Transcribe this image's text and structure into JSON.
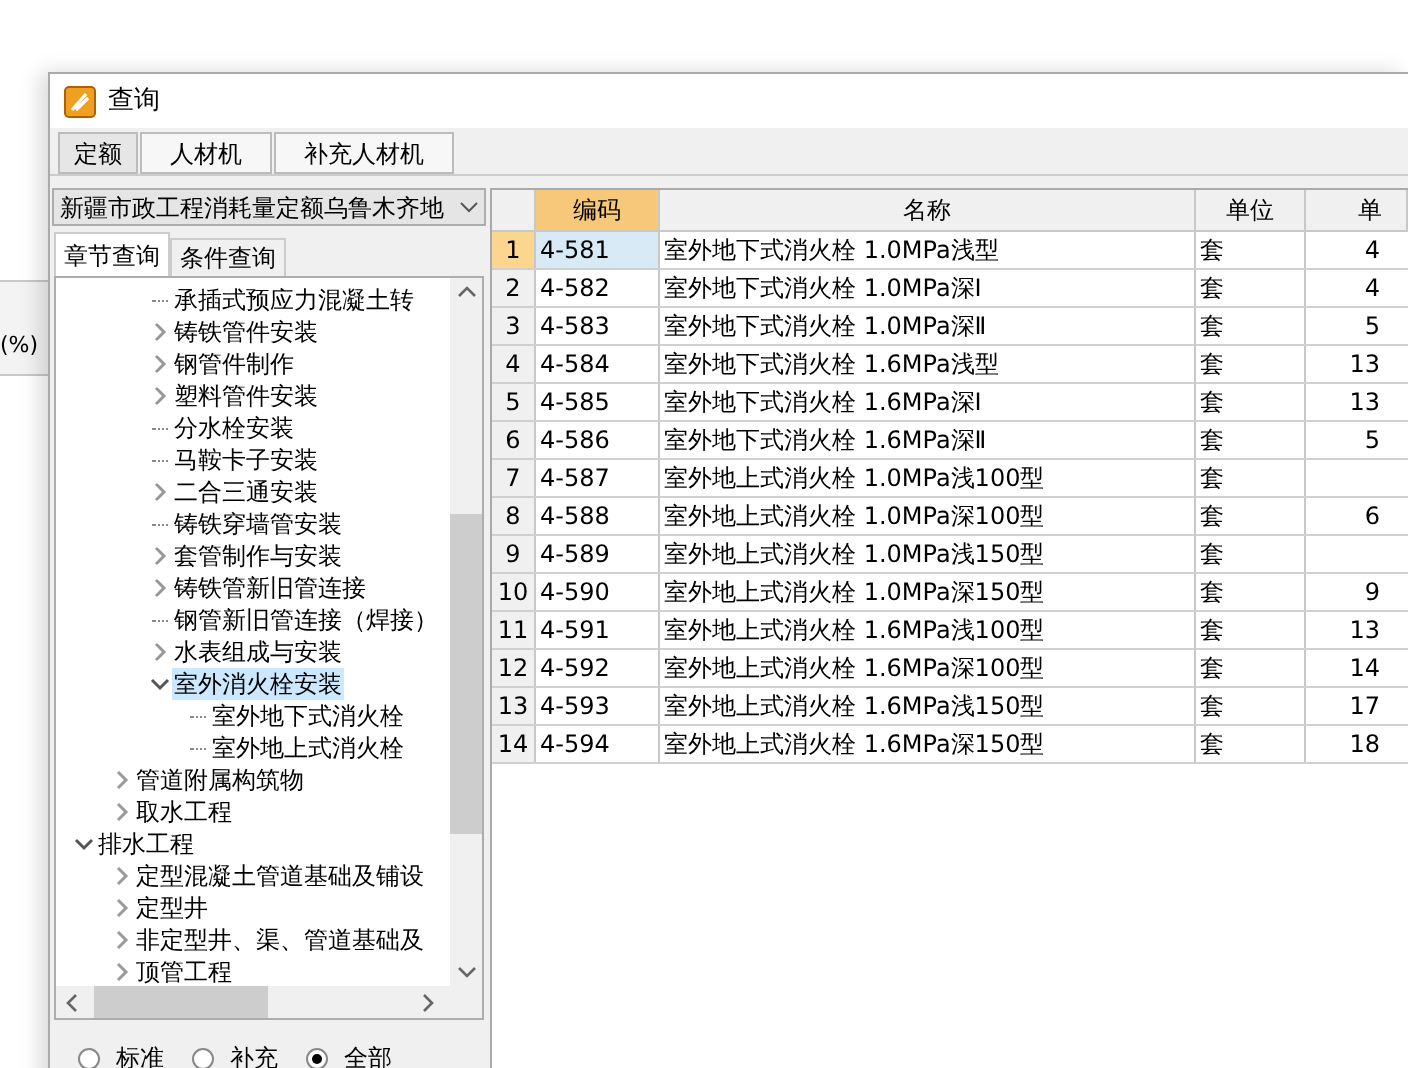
{
  "background": {
    "column_label": "(%)"
  },
  "window": {
    "title": "查询"
  },
  "tabs": [
    {
      "label": "定额",
      "selected": true
    },
    {
      "label": "人材机",
      "selected": false
    },
    {
      "label": "补充人材机",
      "selected": false
    }
  ],
  "quota_dropdown": {
    "value": "新疆市政工程消耗量定额乌鲁木齐地"
  },
  "search_tabs": [
    {
      "label": "章节查询",
      "selected": true
    },
    {
      "label": "条件查询",
      "selected": false
    }
  ],
  "tree": [
    {
      "children": [
        {
          "children": [
            {
              "label": "承插式预应力混凝土转",
              "kind": "leaf",
              "selected": false
            },
            {
              "label": "铸铁管件安装",
              "kind": "branch",
              "expanded": false,
              "selected": false
            },
            {
              "label": "钢管件制作",
              "kind": "branch",
              "expanded": false,
              "selected": false
            },
            {
              "label": "塑料管件安装",
              "kind": "branch",
              "expanded": false,
              "selected": false
            },
            {
              "label": "分水栓安装",
              "kind": "leaf",
              "selected": false
            },
            {
              "label": "马鞍卡子安装",
              "kind": "leaf",
              "selected": false
            },
            {
              "label": "二合三通安装",
              "kind": "branch",
              "expanded": false,
              "selected": false
            },
            {
              "label": "铸铁穿墙管安装",
              "kind": "leaf",
              "selected": false
            },
            {
              "label": "套管制作与安装",
              "kind": "branch",
              "expanded": false,
              "selected": false
            },
            {
              "label": "铸铁管新旧管连接",
              "kind": "branch",
              "expanded": false,
              "selected": false
            },
            {
              "label": "钢管新旧管连接（焊接）",
              "kind": "leaf",
              "selected": false
            },
            {
              "label": "水表组成与安装",
              "kind": "branch",
              "expanded": false,
              "selected": false
            },
            {
              "label": "室外消火栓安装",
              "kind": "branch",
              "expanded": true,
              "selected": true,
              "children": [
                {
                  "label": "室外地下式消火栓",
                  "kind": "leaf",
                  "selected": false
                },
                {
                  "label": "室外地上式消火栓",
                  "kind": "leaf",
                  "selected": false
                }
              ]
            }
          ]
        },
        {
          "label": "管道附属构筑物",
          "kind": "branch",
          "expanded": false,
          "selected": false
        },
        {
          "label": "取水工程",
          "kind": "branch",
          "expanded": false,
          "selected": false
        }
      ]
    },
    {
      "label": "排水工程",
      "kind": "branch",
      "expanded": true,
      "selected": false,
      "children": [
        {
          "label": "定型混凝土管道基础及铺设",
          "kind": "branch",
          "expanded": false,
          "selected": false
        },
        {
          "label": "定型井",
          "kind": "branch",
          "expanded": false,
          "selected": false
        },
        {
          "label": "非定型井、渠、管道基础及",
          "kind": "branch",
          "expanded": false,
          "selected": false
        },
        {
          "label": "顶管工程",
          "kind": "branch",
          "expanded": false,
          "selected": false
        }
      ]
    }
  ],
  "filter": [
    {
      "label": "标准",
      "selected": false
    },
    {
      "label": "补充",
      "selected": false
    },
    {
      "label": "全部",
      "selected": true
    }
  ],
  "table": {
    "columns": [
      {
        "label": "编码",
        "selected": true
      },
      {
        "label": "名称",
        "selected": false
      },
      {
        "label": "单位",
        "selected": false
      },
      {
        "label": "单",
        "selected": false
      }
    ],
    "rows": [
      {
        "index": "1",
        "code": "4-581",
        "name": "室外地下式消火栓 1.0MPa浅型",
        "unit": "套",
        "price": "4",
        "selected": true
      },
      {
        "index": "2",
        "code": "4-582",
        "name": "室外地下式消火栓 1.0MPa深Ⅰ",
        "unit": "套",
        "price": "4",
        "selected": false
      },
      {
        "index": "3",
        "code": "4-583",
        "name": "室外地下式消火栓 1.0MPa深Ⅱ",
        "unit": "套",
        "price": "5",
        "selected": false
      },
      {
        "index": "4",
        "code": "4-584",
        "name": "室外地下式消火栓 1.6MPa浅型",
        "unit": "套",
        "price": "13",
        "selected": false
      },
      {
        "index": "5",
        "code": "4-585",
        "name": "室外地下式消火栓 1.6MPa深Ⅰ",
        "unit": "套",
        "price": "13",
        "selected": false
      },
      {
        "index": "6",
        "code": "4-586",
        "name": "室外地下式消火栓 1.6MPa深Ⅱ",
        "unit": "套",
        "price": "5",
        "selected": false
      },
      {
        "index": "7",
        "code": "4-587",
        "name": "室外地上式消火栓 1.0MPa浅100型",
        "unit": "套",
        "selected": false
      },
      {
        "index": "8",
        "code": "4-588",
        "name": "室外地上式消火栓 1.0MPa深100型",
        "unit": "套",
        "price": "6",
        "selected": false
      },
      {
        "index": "9",
        "code": "4-589",
        "name": "室外地上式消火栓 1.0MPa浅150型",
        "unit": "套",
        "selected": false
      },
      {
        "index": "10",
        "code": "4-590",
        "name": "室外地上式消火栓 1.0MPa深150型",
        "unit": "套",
        "price": "9",
        "selected": false
      },
      {
        "index": "11",
        "code": "4-591",
        "name": "室外地上式消火栓 1.6MPa浅100型",
        "unit": "套",
        "price": "13",
        "selected": false
      },
      {
        "index": "12",
        "code": "4-592",
        "name": "室外地上式消火栓 1.6MPa深100型",
        "unit": "套",
        "price": "14",
        "selected": false
      },
      {
        "index": "13",
        "code": "4-593",
        "name": "室外地上式消火栓 1.6MPa浅150型",
        "unit": "套",
        "price": "17",
        "selected": false
      },
      {
        "index": "14",
        "code": "4-594",
        "name": "室外地上式消火栓 1.6MPa深150型",
        "unit": "套",
        "price": "18",
        "selected": false
      }
    ]
  }
}
